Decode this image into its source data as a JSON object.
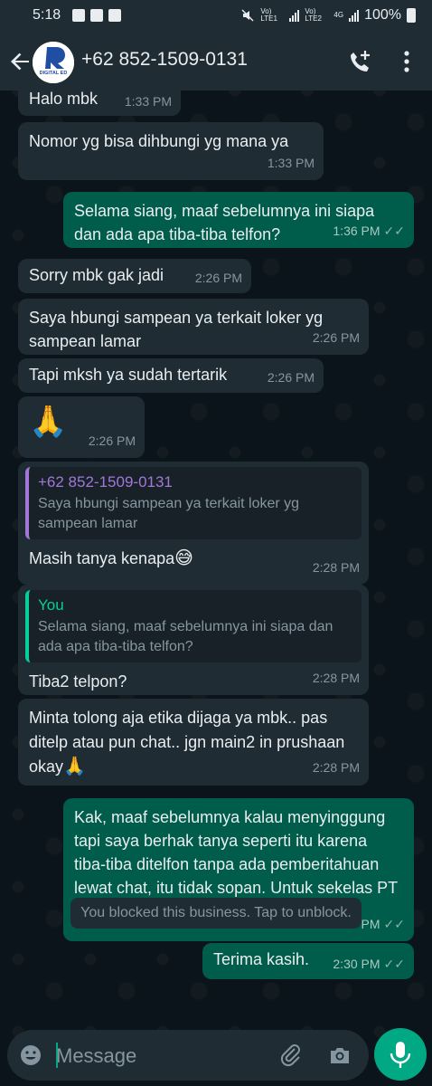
{
  "status_bar": {
    "time": "5:18",
    "sim1": "Vo) LTE1",
    "sim2": "Vo) LTE2",
    "network": "4G",
    "battery": "100%"
  },
  "header": {
    "contact": "+62 852-1509-0131",
    "avatar_text": "DIGITAL ED",
    "icons": [
      "back-arrow-icon",
      "add-call-icon",
      "more-vert-icon"
    ]
  },
  "messages": [
    {
      "dir": "in",
      "text": "Halo mbk",
      "time": "1:33 PM"
    },
    {
      "dir": "in",
      "text": "Nomor yg bisa dihbungi yg mana ya",
      "time": "1:33 PM"
    },
    {
      "dir": "out",
      "text": "Selama siang, maaf sebelumnya ini siapa dan ada apa tiba-tiba telfon?",
      "time": "1:36 PM"
    },
    {
      "dir": "in",
      "text": "Sorry mbk gak jadi",
      "time": "2:26 PM"
    },
    {
      "dir": "in",
      "text": "Saya hbungi sampean ya terkait loker yg sampean lamar",
      "time": "2:26 PM"
    },
    {
      "dir": "in",
      "text": "Tapi mksh ya sudah tertarik",
      "time": "2:26 PM"
    },
    {
      "dir": "in",
      "text": "🙏",
      "time": "2:26 PM"
    },
    {
      "dir": "in",
      "quote_name": "+62 852-1509-0131",
      "quote_text": "Saya hbungi sampean ya terkait loker yg sampean lamar",
      "text": "Masih tanya kenapa",
      "emoji": "😅",
      "time": "2:28 PM"
    },
    {
      "dir": "in",
      "quote_name": "You",
      "quote_text": "Selama siang, maaf sebelumnya ini siapa dan ada apa tiba-tiba telfon?",
      "text": "Tiba2 telpon?",
      "time": "2:28 PM"
    },
    {
      "dir": "in",
      "text": "Minta tolong aja etika dijaga ya mbk.. pas ditelp atau pun chat.. jgn main2 in prushaan okay",
      "emoji": "🙏",
      "time": "2:28 PM"
    },
    {
      "dir": "out",
      "text": "Kak, maaf sebelumnya kalau menyinggung tapi saya berhak tanya seperti itu karena tiba-tiba ditelfon tanpa ada pemberitahuan lewat chat, itu tidak sopan. Untuk sekelas PT buat hire karyawan aja sejelek ini.",
      "time": "2:30 PM"
    },
    {
      "dir": "out",
      "text": "Terima kasih.",
      "time": "2:30 PM"
    }
  ],
  "system_notice": "You blocked this business. Tap to unblock.",
  "composer": {
    "placeholder": "Message",
    "icons": [
      "emoji-icon",
      "attach-icon",
      "camera-icon",
      "mic-icon"
    ]
  },
  "colors": {
    "background": "#0b141a",
    "incoming_bubble": "#1f2c34",
    "outgoing_bubble": "#005c4b",
    "accent": "#00a884",
    "quote_sender": "#a277d8"
  }
}
